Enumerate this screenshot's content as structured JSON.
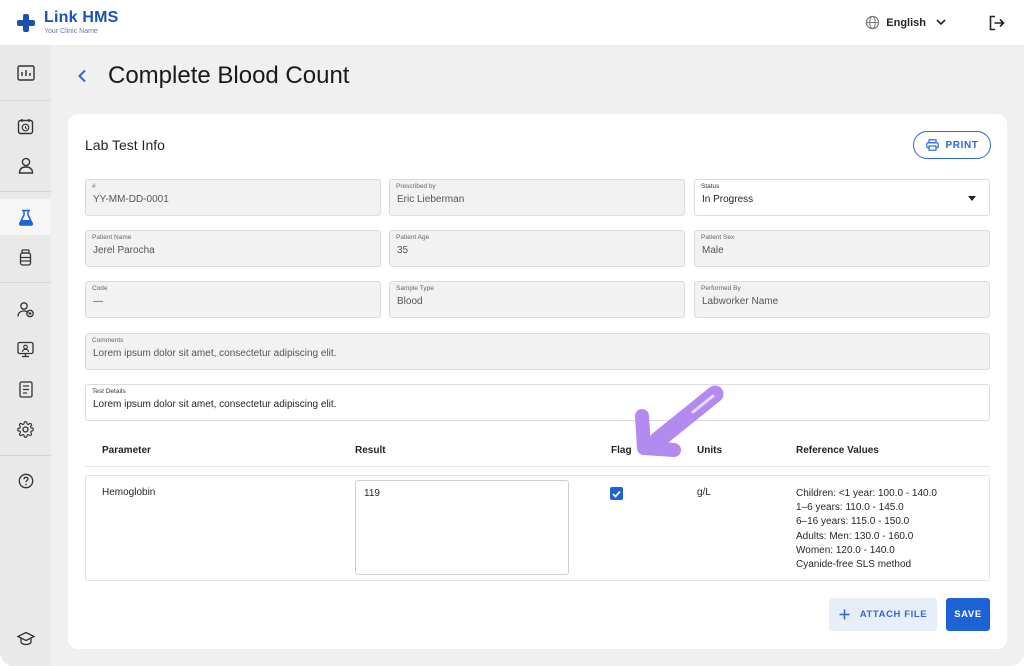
{
  "app": {
    "name": "Link HMS",
    "subtitle": "Your Clinic Name"
  },
  "header": {
    "language": "English",
    "icons": [
      "globe-icon",
      "chevron-down-icon",
      "logout-icon"
    ]
  },
  "sidebar": {
    "items": [
      {
        "icon": "dashboard-icon",
        "active": false
      },
      {
        "icon": "appointment-clock-icon",
        "active": false
      },
      {
        "icon": "user-icon",
        "active": false
      },
      {
        "icon": "lab-flask-icon",
        "active": true
      },
      {
        "icon": "medicine-bottle-icon",
        "active": false
      },
      {
        "icon": "staff-group-icon",
        "active": false
      },
      {
        "icon": "monitor-icon",
        "active": false
      },
      {
        "icon": "report-icon",
        "active": false
      },
      {
        "icon": "settings-icon",
        "active": false
      },
      {
        "icon": "help-icon",
        "active": false
      },
      {
        "icon": "graduation-cap-icon",
        "active": false
      }
    ]
  },
  "page": {
    "title": "Complete Blood Count"
  },
  "card": {
    "title": "Lab Test Info",
    "print_label": "PRINT"
  },
  "fields": {
    "id": {
      "label": "#",
      "value": "YY-MM-DD-0001"
    },
    "prescribed_by": {
      "label": "Prescribed by",
      "value": "Eric Lieberman"
    },
    "status": {
      "label": "Status",
      "value": "In Progress"
    },
    "patient_name": {
      "label": "Patient Name",
      "value": "Jerel Parocha"
    },
    "patient_age": {
      "label": "Patient Age",
      "value": "35"
    },
    "patient_sex": {
      "label": "Patient Sex",
      "value": "Male"
    },
    "code": {
      "label": "Code",
      "value": "—"
    },
    "sample_type": {
      "label": "Sample Type",
      "value": "Blood"
    },
    "performed_by": {
      "label": "Performed By",
      "value": "Labworker Name"
    },
    "comments": {
      "label": "Comments",
      "value": "Lorem ipsum dolor sit amet, consectetur adipiscing elit."
    },
    "test_details": {
      "label": "Test Details",
      "value": "Lorem ipsum dolor sit amet, consectetur adipiscing elit."
    }
  },
  "table": {
    "headers": {
      "parameter": "Parameter",
      "result": "Result",
      "flag": "Flag",
      "units": "Units",
      "reference": "Reference Values"
    },
    "rows": [
      {
        "parameter": "Hemoglobin",
        "result": "119",
        "flag_checked": true,
        "units": "g/L",
        "reference_lines": [
          "Children: <1 year: 100.0 - 140.0",
          "1–6 years: 110.0 - 145.0",
          "6–16 years: 115.0 - 150.0",
          "Adults: Men: 130.0 - 160.0",
          "Women: 120.0 - 140.0",
          "Cyanide-free SLS method"
        ]
      }
    ]
  },
  "actions": {
    "attach_label": "ATTACH FILE",
    "save_label": "SAVE"
  },
  "colors": {
    "brand": "#1e4fb3",
    "primary": "#1e63d6",
    "annotation": "#b28af0"
  }
}
